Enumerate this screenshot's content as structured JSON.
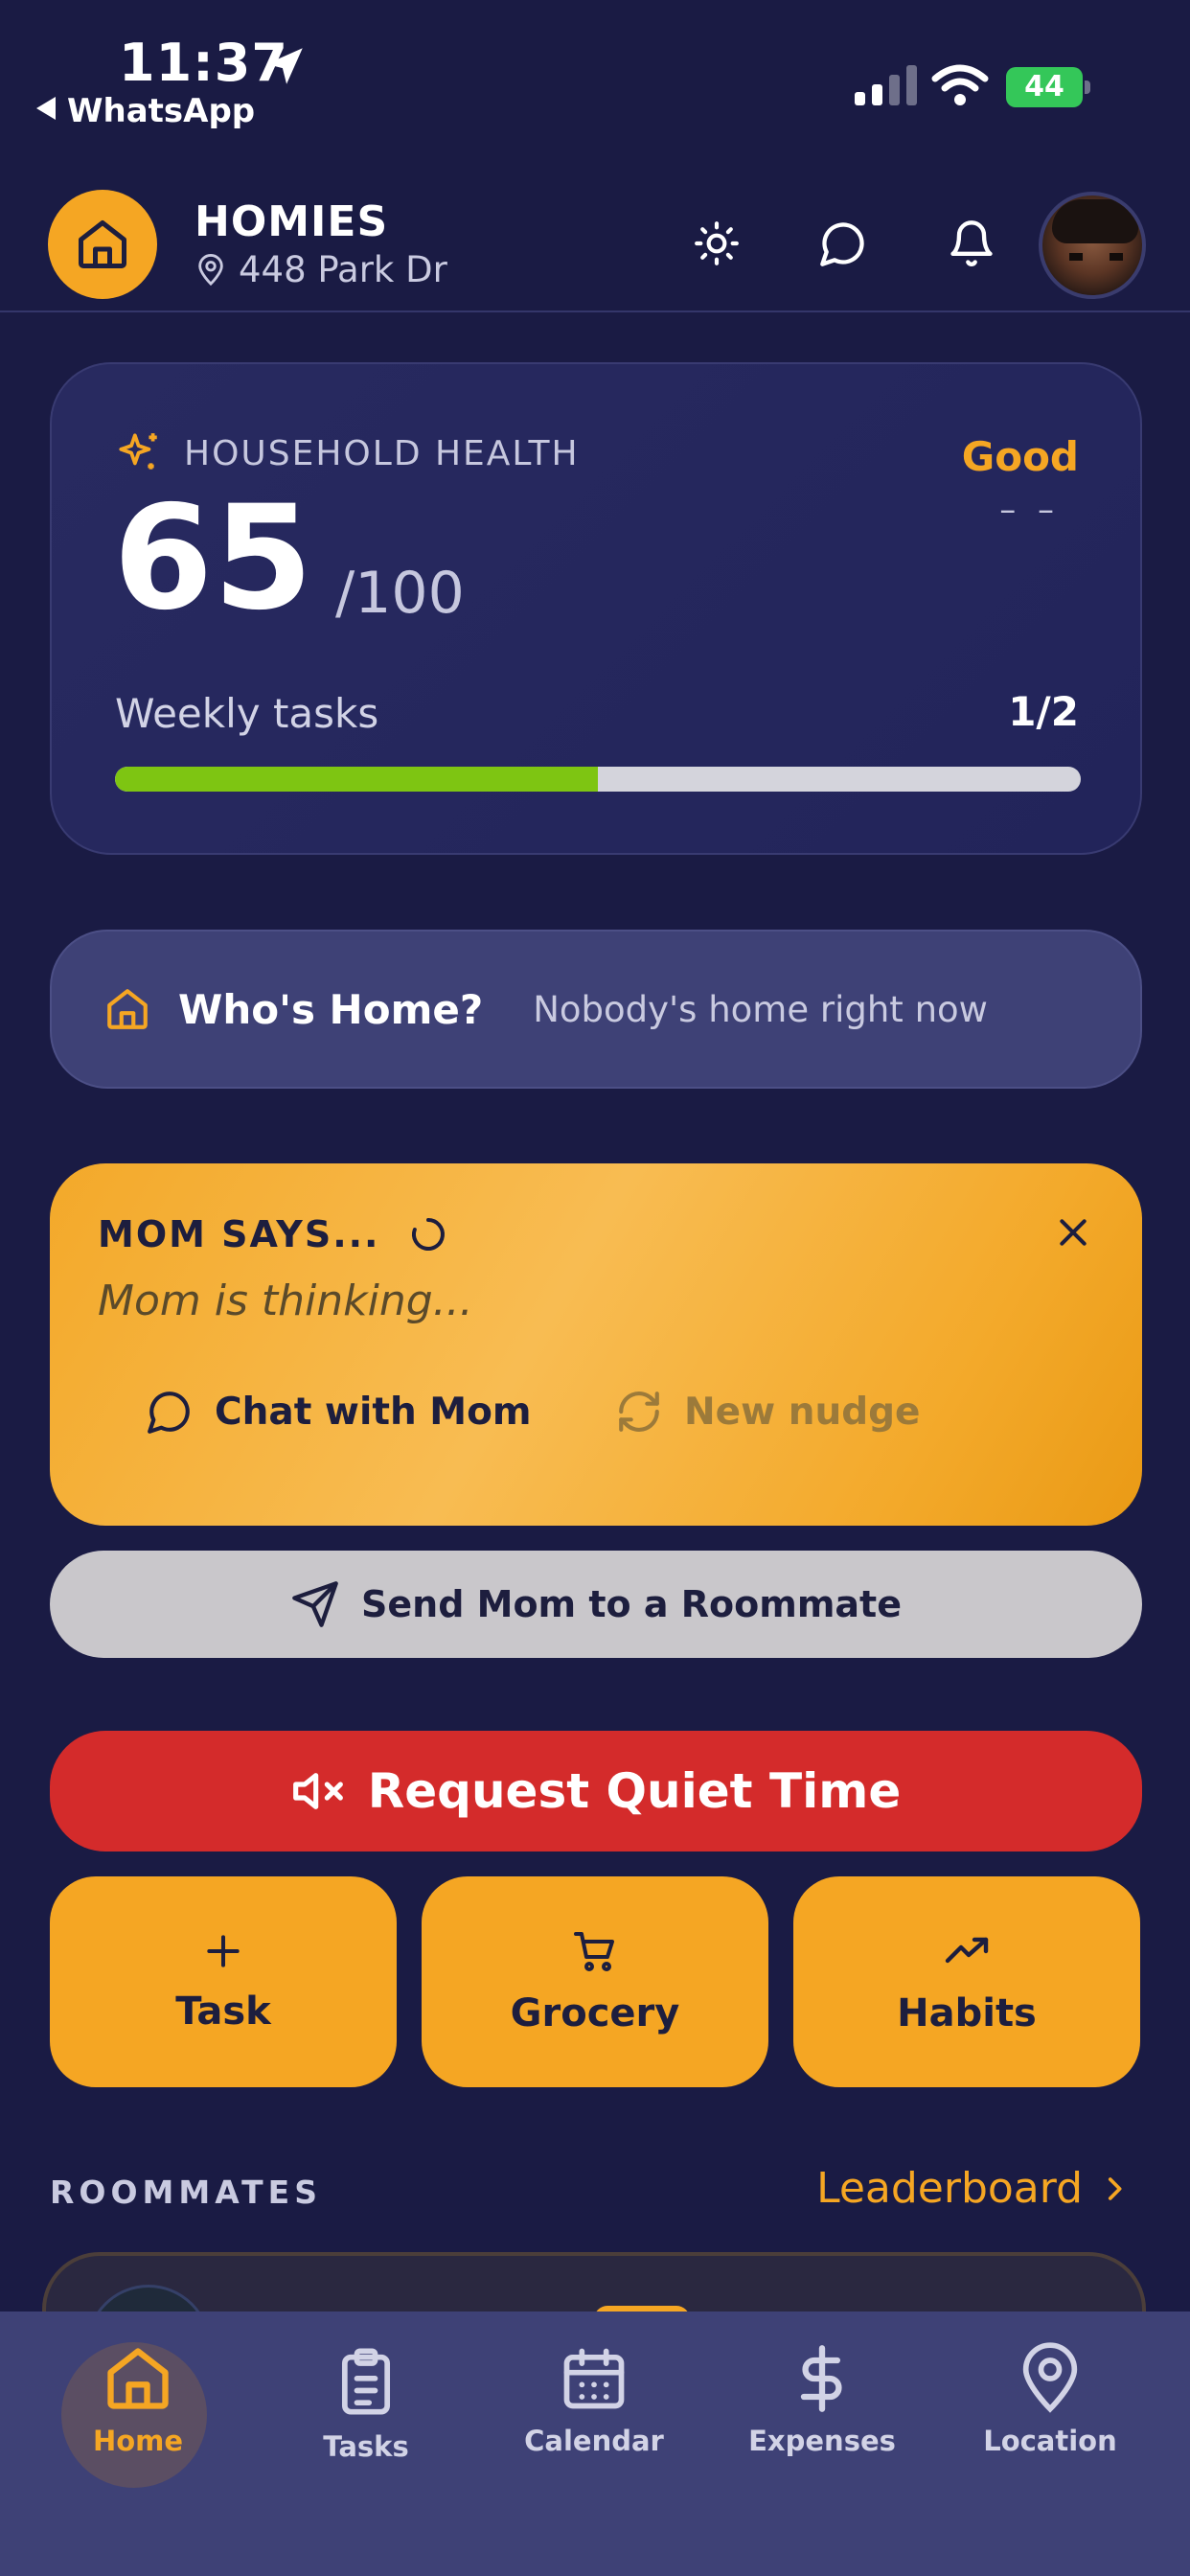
{
  "status_bar": {
    "time": "11:37",
    "back_app": "WhatsApp",
    "battery": "44"
  },
  "header": {
    "household_name": "HOMIES",
    "address": "448 Park Dr"
  },
  "health": {
    "label": "HOUSEHOLD HEALTH",
    "score": "65",
    "max": "/100",
    "status": "Good",
    "trend": "– –",
    "weekly_label": "Weekly tasks",
    "weekly_count": "1/2",
    "weekly_progress": 0.5
  },
  "whos_home": {
    "title": "Who's Home?",
    "status": "Nobody's home right now"
  },
  "mom": {
    "title": "MOM SAYS...",
    "message": "Mom is thinking...",
    "chat_label": "Chat with Mom",
    "nudge_label": "New nudge"
  },
  "send_mom_label": "Send Mom to a Roommate",
  "quiet_time_label": "Request Quiet Time",
  "quick_actions": [
    {
      "label": "Task",
      "icon": "plus-icon"
    },
    {
      "label": "Grocery",
      "icon": "cart-icon"
    },
    {
      "label": "Habits",
      "icon": "trending-up-icon"
    }
  ],
  "roommates": {
    "title": "ROOMMATES",
    "leaderboard_label": "Leaderboard"
  },
  "nav": [
    {
      "label": "Home",
      "icon": "home-icon",
      "active": true
    },
    {
      "label": "Tasks",
      "icon": "clipboard-icon"
    },
    {
      "label": "Calendar",
      "icon": "calendar-icon"
    },
    {
      "label": "Expenses",
      "icon": "dollar-icon"
    },
    {
      "label": "Location",
      "icon": "map-pin-icon"
    }
  ],
  "colors": {
    "background": "#1a1b44",
    "accent": "#f5a623",
    "danger": "#d42b2b",
    "progress": "#7ec512"
  }
}
